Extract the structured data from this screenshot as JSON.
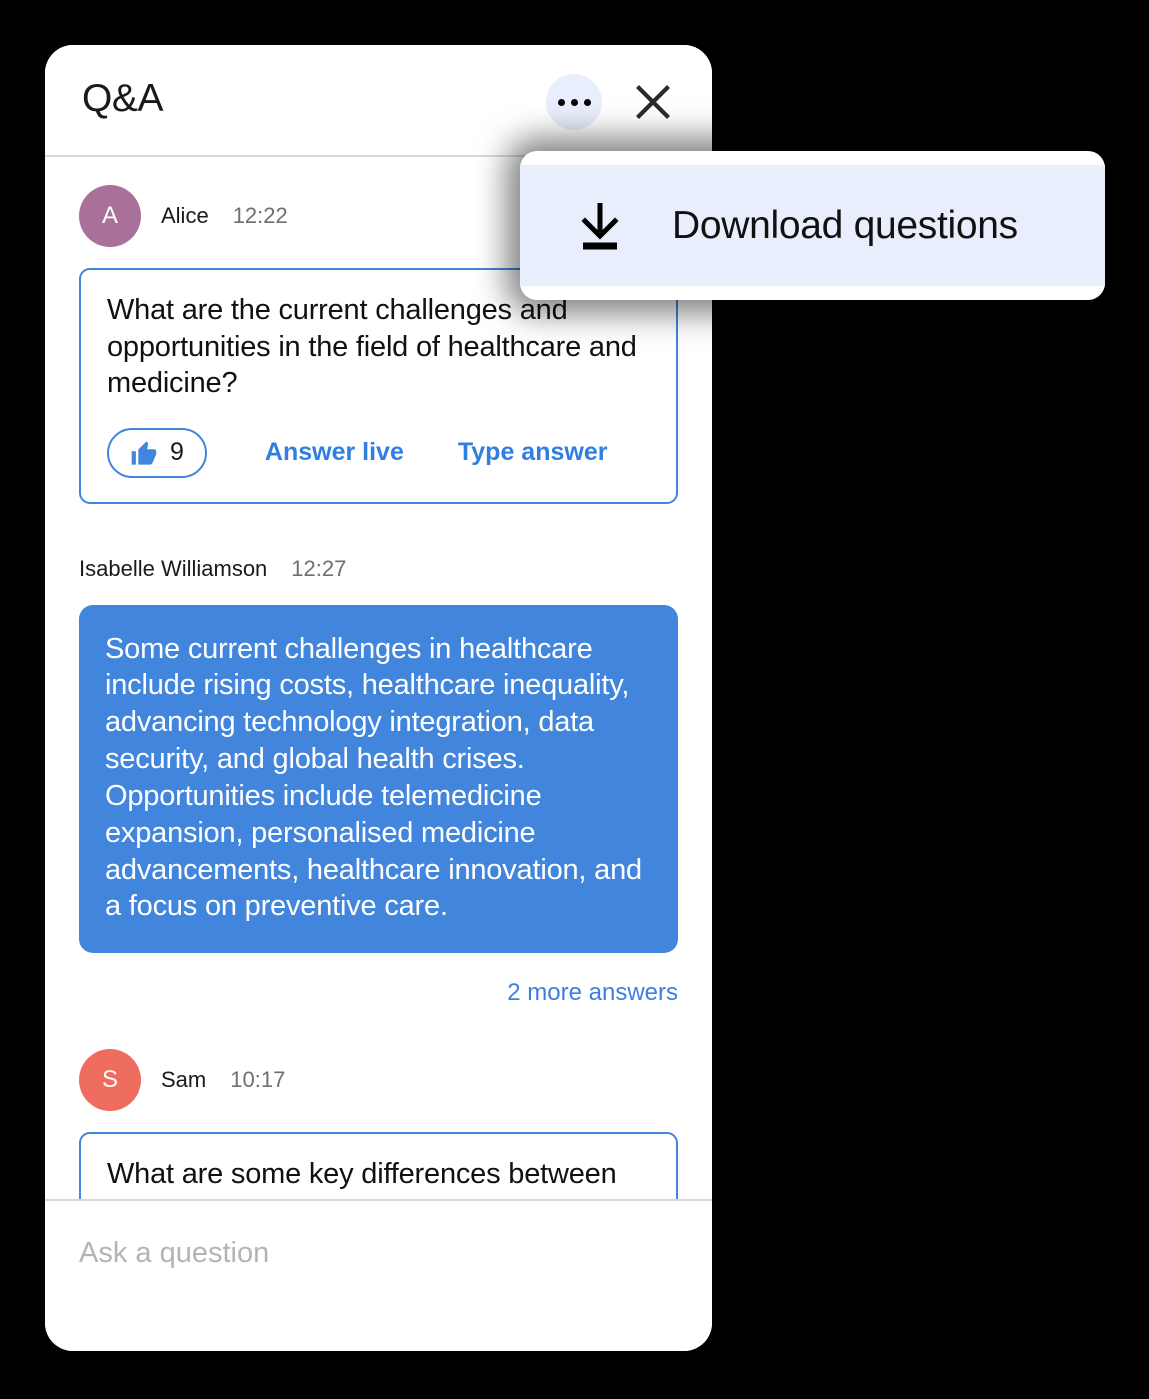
{
  "panel": {
    "title": "Q&A",
    "more_icon": "ellipsis-icon",
    "close_icon": "close-icon"
  },
  "menu": {
    "items": [
      {
        "label": "Download questions",
        "icon": "download-icon",
        "highlighted": true
      }
    ]
  },
  "thread": {
    "questions": [
      {
        "author": "Alice",
        "avatar_initial": "A",
        "avatar_color": "#a9709a",
        "time": "12:22",
        "text": "What are the current challenges and opportunities in the field of healthcare and medicine?",
        "like_count": "9",
        "like_icon": "thumbs-up-icon",
        "answer_live_label": "Answer live",
        "type_answer_label": "Type answer",
        "answer": {
          "author": "Isabelle Williamson",
          "time": "12:27",
          "text": "Some current challenges in healthcare include rising costs, healthcare inequality, advancing technology integration, data security, and global health crises. Opportunities include telemedicine expansion, personalised medicine advancements, healthcare innovation, and a focus on preventive care."
        },
        "more_answers_label": "2 more answers"
      },
      {
        "author": "Sam",
        "avatar_initial": "S",
        "avatar_color": "#ee6d5e",
        "time": "10:17",
        "text": "What are some key differences between Eastern and Western approaches to medicine?"
      }
    ]
  },
  "composer": {
    "placeholder": "Ask a question",
    "value": ""
  },
  "colors": {
    "accent_blue": "#4285dd",
    "link_blue": "#2f7fe0",
    "menu_highlight": "#e8eefb",
    "background": "#000000"
  }
}
